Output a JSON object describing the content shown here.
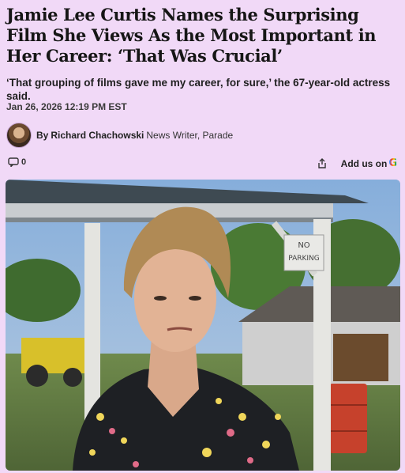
{
  "article": {
    "headline": "Jamie Lee Curtis Names the Surprising Film She Views As the Most Important in Her Career: ‘That Was Crucial’",
    "dek": "‘That grouping of films gave me my career, for sure,’ the 67-year-old actress said.",
    "date": "Jan 26, 2026 12:19 PM EST",
    "byline": {
      "prefix": "By",
      "author": "Richard Chachowski",
      "role": "News Writer, Parade"
    },
    "comments_count": "0",
    "add_on_label": "Add us on"
  },
  "photo": {
    "sign_text_line1": "NO",
    "sign_text_line2": "PARKING"
  },
  "icons": {
    "comment": "comment-bubble-icon",
    "share": "share-icon",
    "google": "google-g-icon"
  },
  "colors": {
    "background": "#f1d9f7",
    "text": "#1b1b1b"
  }
}
